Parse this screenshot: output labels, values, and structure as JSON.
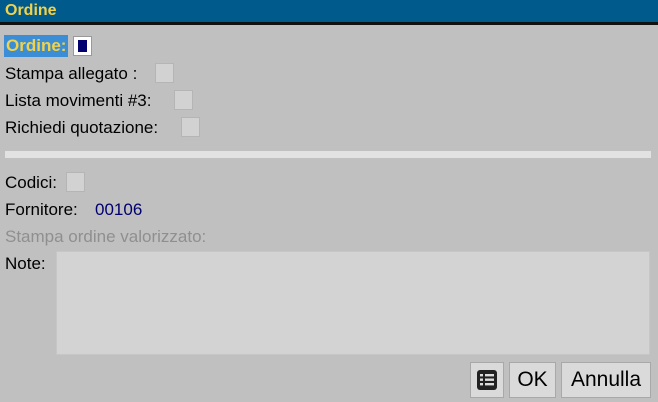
{
  "window": {
    "title": "Ordine"
  },
  "form": {
    "ordine_label": "Ordine:",
    "stampa_allegato_label": "Stampa allegato :",
    "lista_movimenti_label": "Lista movimenti #3:",
    "richiedi_quotazione_label": "Richiedi quotazione:",
    "codici_label": "Codici:",
    "fornitore_label": "Fornitore:",
    "fornitore_value": "00106",
    "stampa_valorizzato_label": "Stampa ordine valorizzato:",
    "note_label": "Note:",
    "note_value": ""
  },
  "buttons": {
    "grid_icon": "table-list-icon",
    "ok_label": "OK",
    "annulla_label": "Annulla"
  },
  "colors": {
    "titlebar": "#005a8c",
    "title_text": "#f2d24a",
    "focus_background": "#3b8ed6",
    "value_text": "#00006e"
  }
}
